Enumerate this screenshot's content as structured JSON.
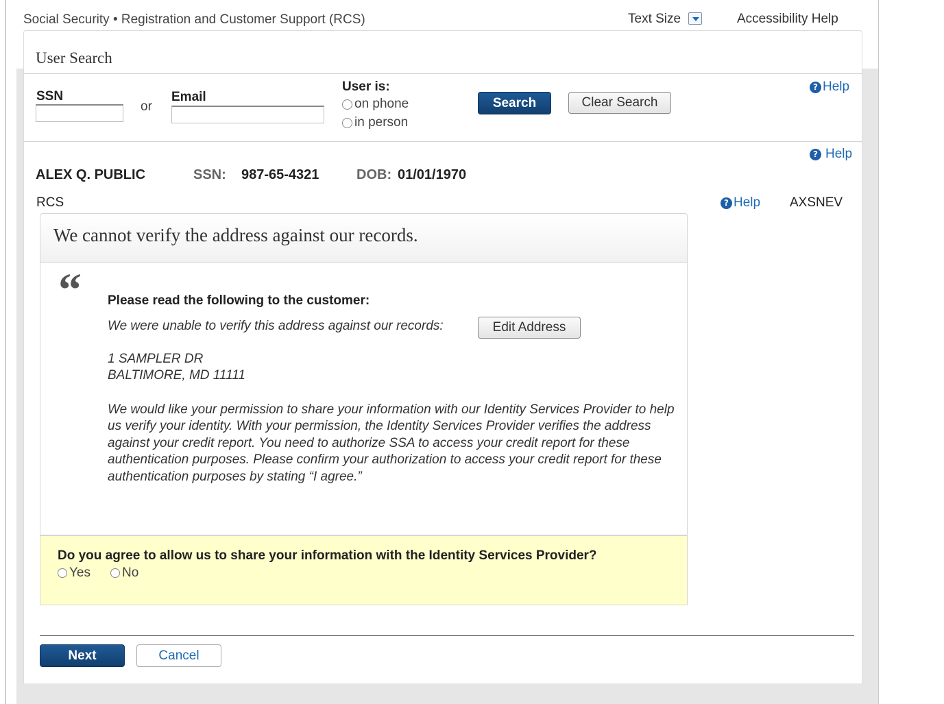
{
  "header": {
    "app_title": "Social Security • Registration and Customer Support (RCS)",
    "text_size": "Text Size",
    "accessibility_help": "Accessibility Help"
  },
  "search": {
    "title": "User Search",
    "ssn_label": "SSN",
    "or_label": "or",
    "email_label": "Email",
    "ssn_value": "",
    "email_value": "",
    "user_is_label": "User is:",
    "user_is_options": [
      "on phone",
      "in person"
    ],
    "search_button": "Search",
    "clear_button": "Clear Search",
    "help": "Help"
  },
  "person": {
    "name": "ALEX Q. PUBLIC",
    "ssn_label": "SSN:",
    "ssn": "987-65-4321",
    "dob_label": "DOB:",
    "dob": "01/01/1970",
    "help": "Help"
  },
  "context": {
    "rcs": "RCS",
    "help": "Help",
    "user_code": "AXSNEV"
  },
  "message": {
    "title": "We cannot verify the address against our records.",
    "quote_mark": "“",
    "read_label": "Please read the following to the customer:",
    "unable_text": "We were unable to verify this address against our records:",
    "edit_button": "Edit Address",
    "address_line1": "1 SAMPLER DR",
    "address_line2": "BALTIMORE, MD 11111",
    "permission_text": "We would like your permission to share your information with our Identity Services Provider to help us verify your identity. With your permission, the Identity Services Provider verifies the address against your credit report.  You need to authorize SSA to access your credit report for these authentication purposes. Please confirm your authorization to access your credit report for these authentication purposes by stating “I agree.”"
  },
  "agree": {
    "question": "Do you agree to allow us to share your information with the Identity Services Provider?",
    "options": [
      "Yes",
      "No"
    ]
  },
  "footer": {
    "next_button": "Next",
    "cancel_button": "Cancel"
  },
  "colors": {
    "primary_button": "#123f6f",
    "link": "#1d6ab5",
    "agree_background": "#ffffcc"
  }
}
